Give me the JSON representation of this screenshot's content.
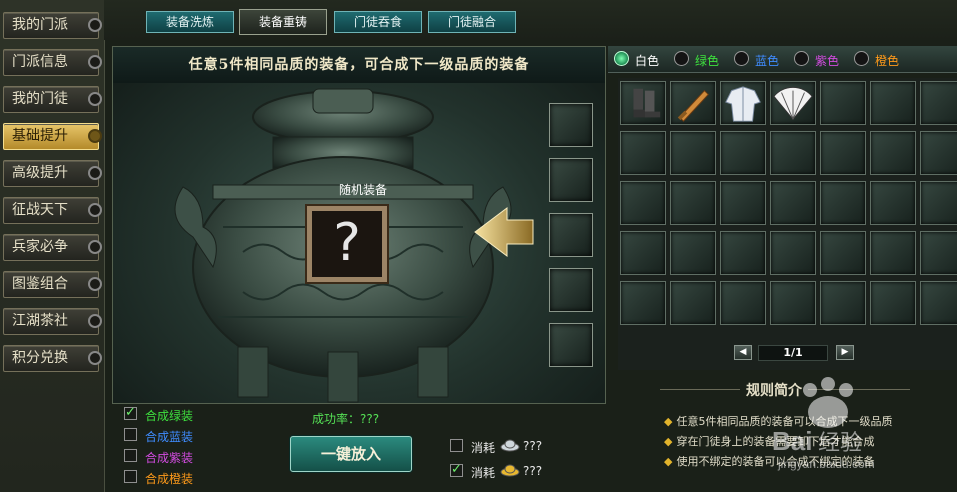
{
  "nav": {
    "items": [
      {
        "label": "我的门派",
        "active": false
      },
      {
        "label": "门派信息",
        "active": false
      },
      {
        "label": "我的门徒",
        "active": false
      },
      {
        "label": "基础提升",
        "active": true
      },
      {
        "label": "高级提升",
        "active": false
      },
      {
        "label": "征战天下",
        "active": false
      },
      {
        "label": "兵家必争",
        "active": false
      },
      {
        "label": "图鉴组合",
        "active": false
      },
      {
        "label": "江湖茶社",
        "active": false
      },
      {
        "label": "积分兑换",
        "active": false
      }
    ]
  },
  "tabs": [
    {
      "label": "装备洗炼",
      "active": false
    },
    {
      "label": "装备重铸",
      "active": true
    },
    {
      "label": "门徒吞食",
      "active": false
    },
    {
      "label": "门徒融合",
      "active": false
    }
  ],
  "furnace": {
    "banner": "任意5件相同品质的装备，可合成下一级品质的装备",
    "slot_label": "随机装备",
    "slot_symbol": "?",
    "success_label": "成功率：???"
  },
  "options": [
    {
      "label": "合成绿装",
      "checked": true,
      "color": "#3ee23e"
    },
    {
      "label": "合成蓝装",
      "checked": false,
      "color": "#3f8cff"
    },
    {
      "label": "合成紫装",
      "checked": false,
      "color": "#d24ce0"
    },
    {
      "label": "合成橙装",
      "checked": false,
      "color": "#ff9a1a"
    }
  ],
  "action": {
    "put_label": "一键放入"
  },
  "costs": [
    {
      "label": "消耗",
      "amount": "???",
      "checked": false,
      "icon": "silver-icon"
    },
    {
      "label": "消耗",
      "amount": "???",
      "checked": true,
      "icon": "gold-icon"
    }
  ],
  "filters": [
    {
      "label": "白色",
      "selected": true,
      "color": "#ffffff"
    },
    {
      "label": "绿色",
      "selected": false,
      "color": "#3ee23e"
    },
    {
      "label": "蓝色",
      "selected": false,
      "color": "#3f8cff"
    },
    {
      "label": "紫色",
      "selected": false,
      "color": "#d24ce0"
    },
    {
      "label": "橙色",
      "selected": false,
      "color": "#ff9a1a"
    }
  ],
  "inventory": {
    "items": [
      "boots-icon",
      "sword-icon",
      "robe-icon",
      "fan-icon"
    ],
    "page": "1/1"
  },
  "rules": {
    "title": "规则简介",
    "lines": [
      "任意5件相同品质的装备可以合成下一级品质",
      "穿在门徒身上的装备需要卸下后才能合成",
      "使用不绑定的装备可以合成不绑定的装备"
    ]
  },
  "watermark": {
    "logo": "Baidu经验",
    "url": "jingyan.baidu.com"
  }
}
